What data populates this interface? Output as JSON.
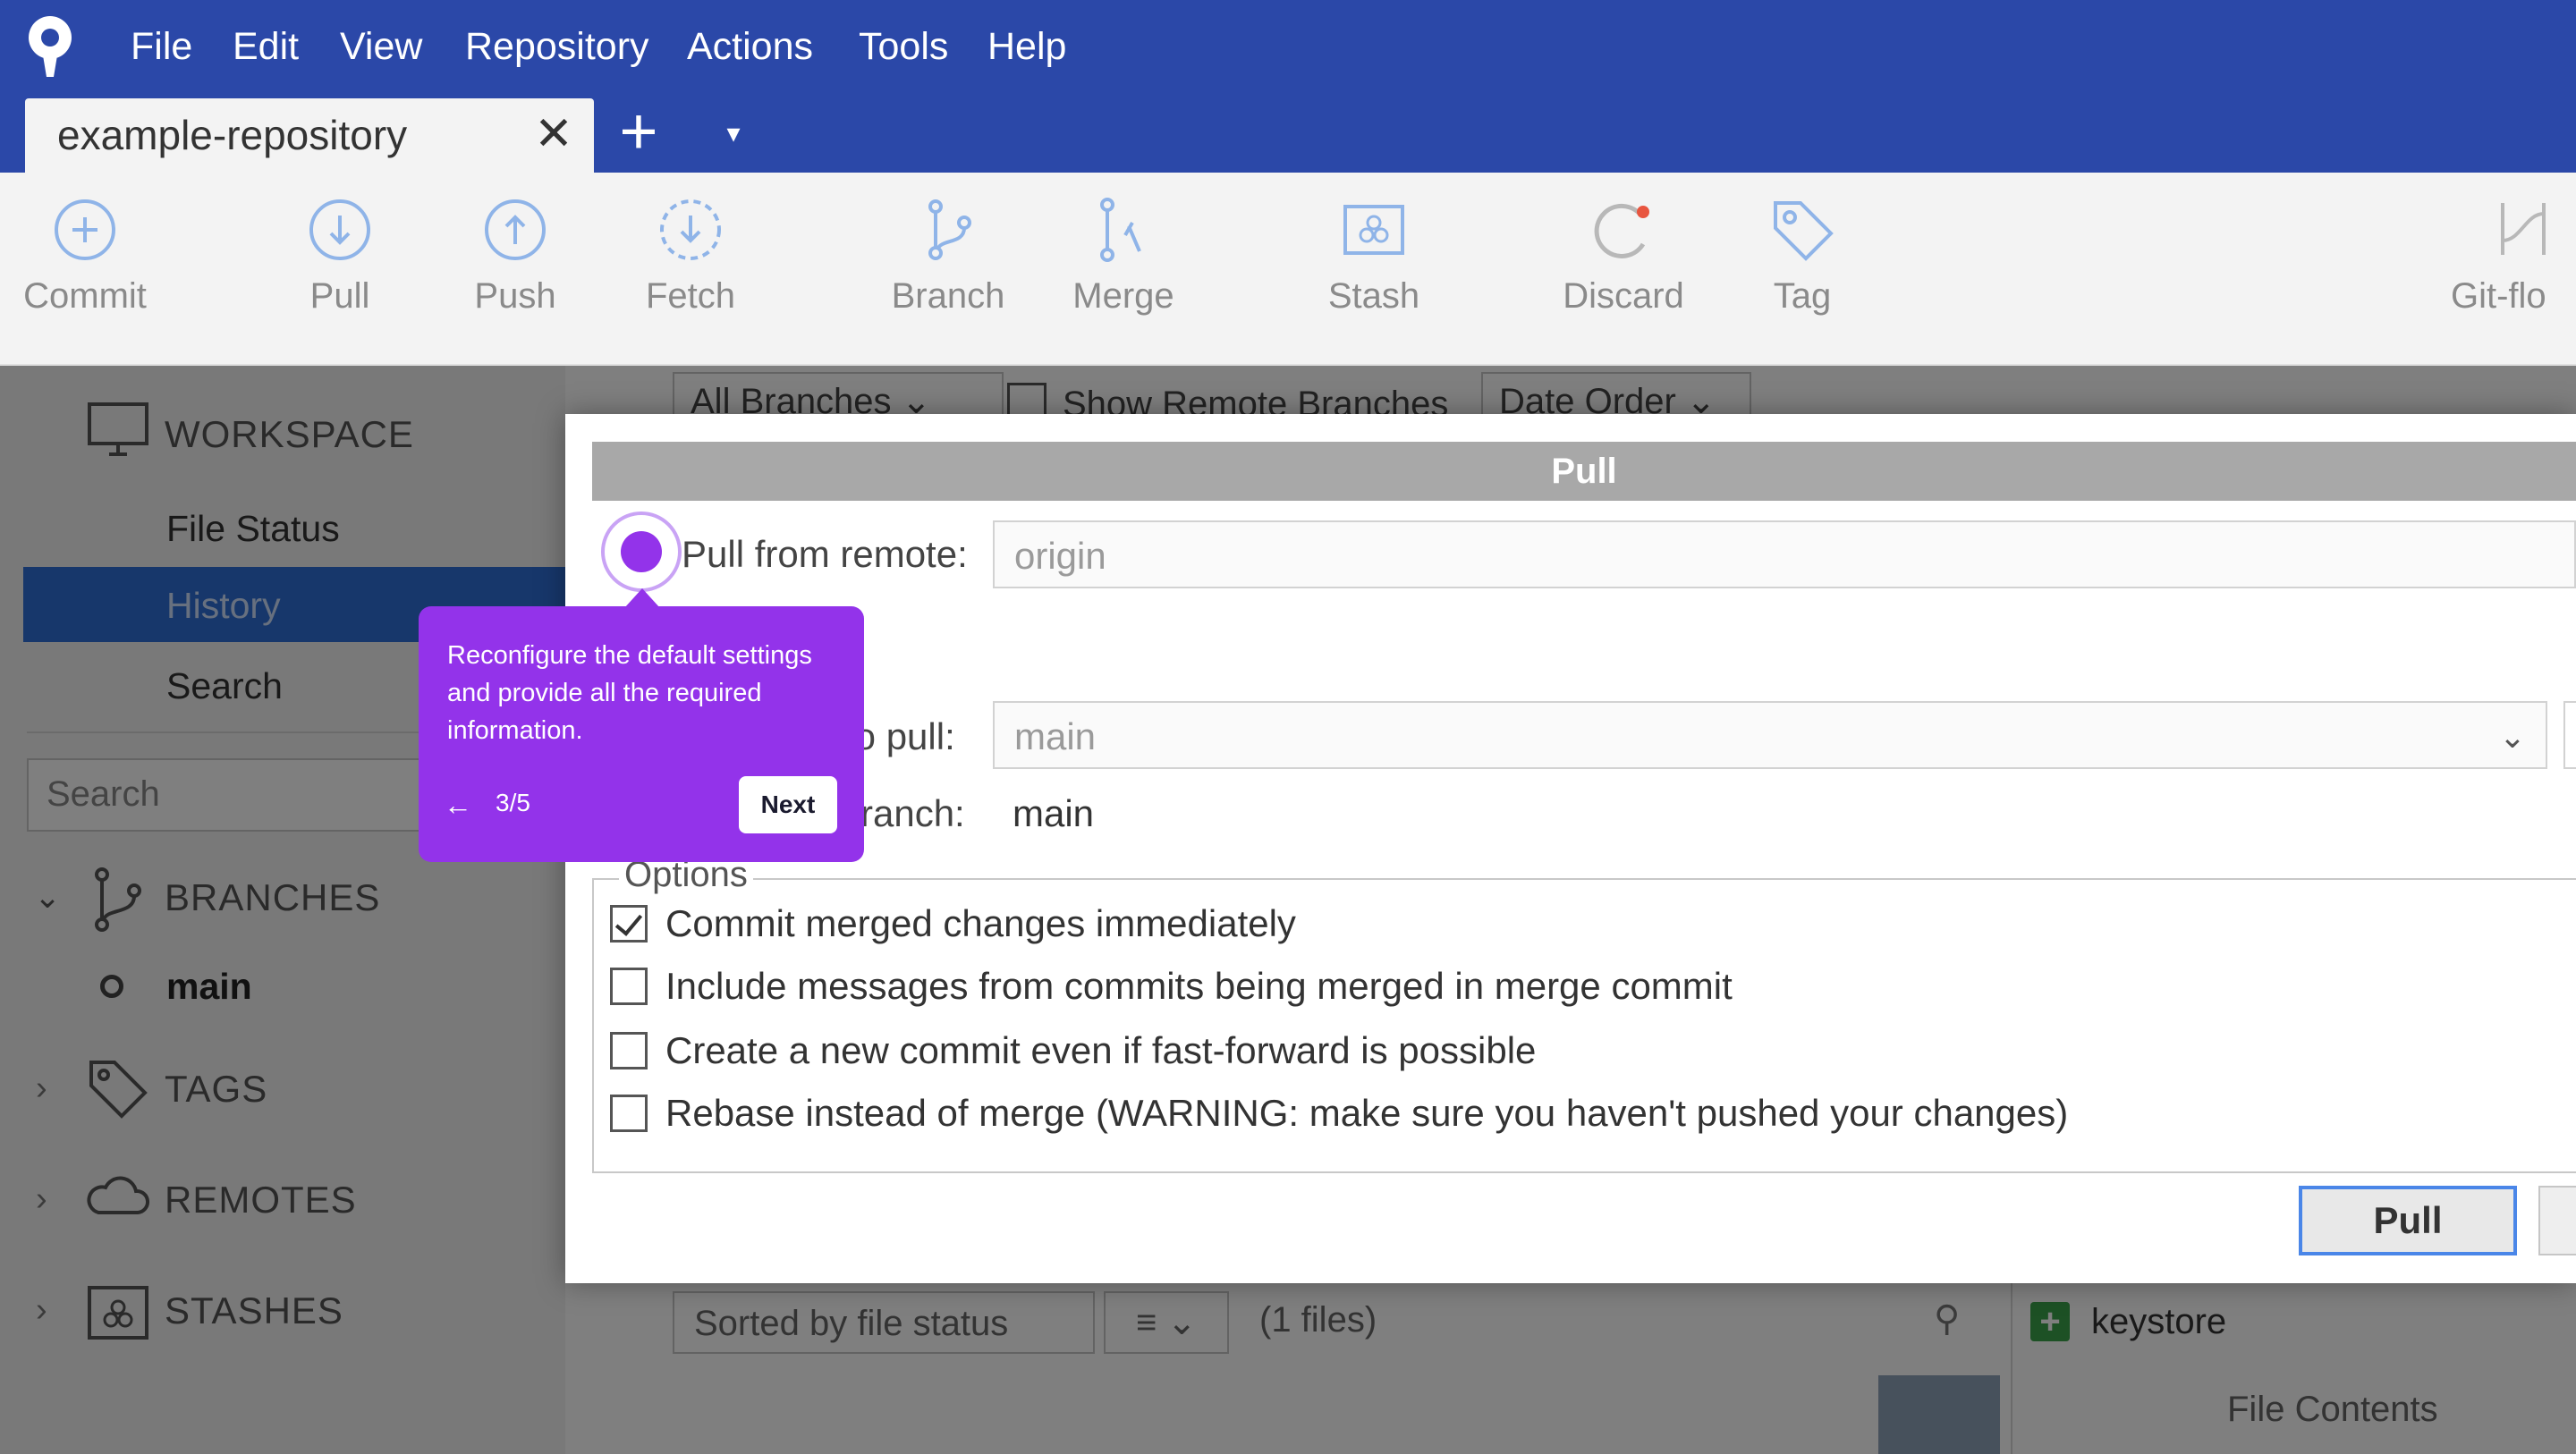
{
  "menu": [
    "File",
    "Edit",
    "View",
    "Repository",
    "Actions",
    "Tools",
    "Help"
  ],
  "tab": {
    "label": "example-repository",
    "close": "✕",
    "add": "+",
    "dropdown": "▾"
  },
  "toolbar": {
    "commit": "Commit",
    "pull": "Pull",
    "push": "Push",
    "fetch": "Fetch",
    "branch": "Branch",
    "merge": "Merge",
    "stash": "Stash",
    "discard": "Discard",
    "tag": "Tag",
    "gitflow": "Git-flo"
  },
  "sidebar": {
    "workspace": "WORKSPACE",
    "file_status": "File Status",
    "history": "History",
    "search": "Search",
    "search_placeholder": "Search",
    "branches": "BRANCHES",
    "branch_main": "main",
    "tags": "TAGS",
    "remotes": "REMOTES",
    "stashes": "STASHES"
  },
  "filters": {
    "all_branches": "All Branches",
    "show_remote": "Show Remote Branches",
    "date_order": "Date Order"
  },
  "bottom": {
    "sort": "Sorted by file status",
    "files": "(1 files)",
    "file_name": "keystore",
    "file_contents": "File Contents"
  },
  "dialog": {
    "title": "Pull",
    "pull_from_remote_label": "Pull from remote:",
    "pull_from_remote_value": "origin",
    "remote_branch_label": "to pull:",
    "remote_branch_value": "main",
    "local_branch_label": "ranch:",
    "local_branch_value": "main",
    "options_legend": "Options",
    "options": [
      {
        "label": "Commit merged changes immediately",
        "checked": true
      },
      {
        "label": "Include messages from commits being merged in merge commit",
        "checked": false
      },
      {
        "label": "Create a new commit even if fast-forward is possible",
        "checked": false
      },
      {
        "label": "Rebase instead of merge (WARNING: make sure you haven't pushed your changes)",
        "checked": false
      }
    ],
    "pull_button": "Pull"
  },
  "tour": {
    "text": "Reconfigure the default settings and provide all the required information.",
    "back": "←",
    "step": "3/5",
    "next": "Next"
  },
  "colors": {
    "titlebar": "#2b48a8",
    "selection": "#2e6fd6",
    "tour_accent": "#9333ea"
  }
}
